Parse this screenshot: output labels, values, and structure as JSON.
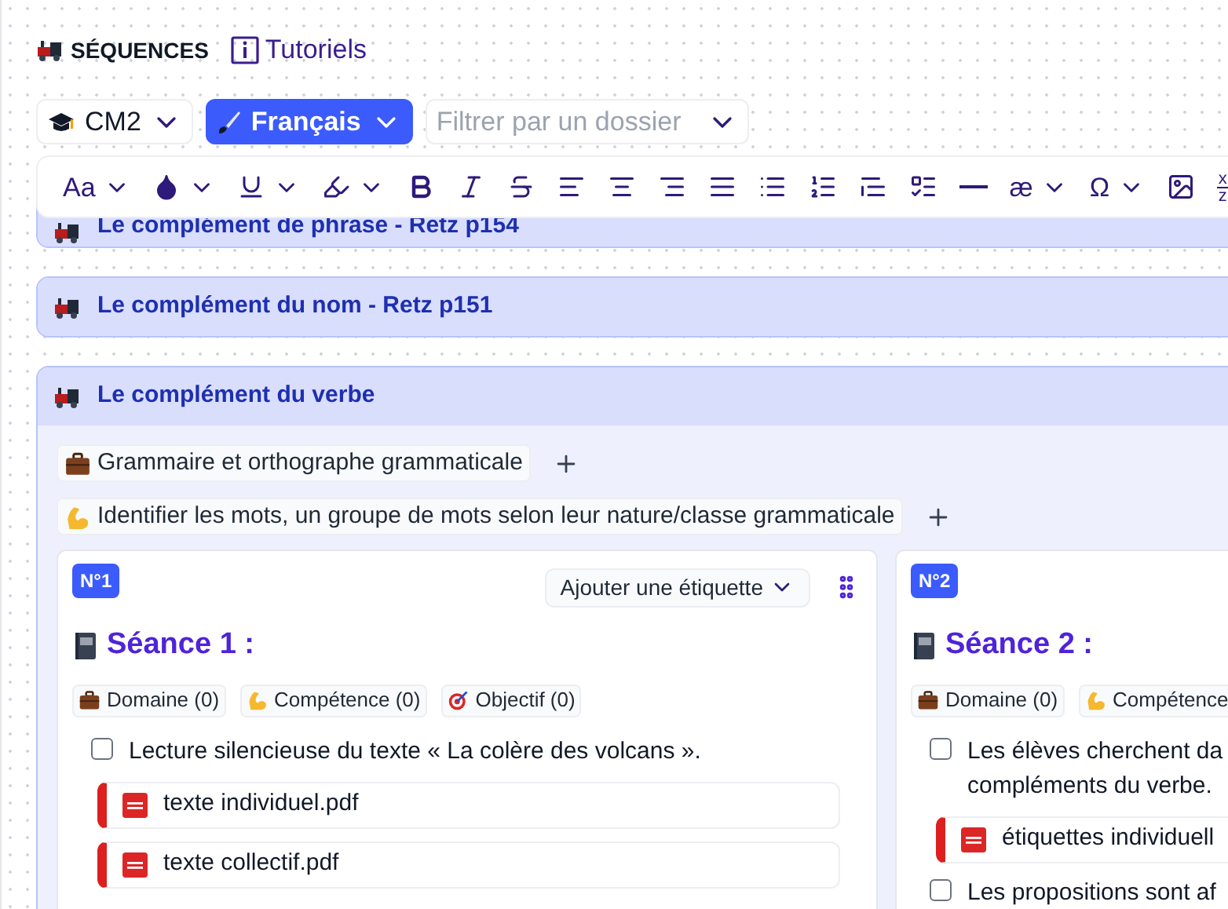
{
  "header": {
    "title": "SÉQUENCES",
    "link": "Tutoriels"
  },
  "filters": [
    {
      "kind": "level",
      "label": "CM2",
      "selected": false
    },
    {
      "kind": "subject",
      "label": "Français",
      "selected": true
    },
    {
      "kind": "folder",
      "placeholder": "Filtrer par un dossier",
      "selected": false
    }
  ],
  "toolbar": [
    {
      "kind": "text",
      "label": "Aa",
      "menu": true
    },
    {
      "kind": "color",
      "menu": true
    },
    {
      "kind": "underline",
      "menu": true
    },
    {
      "kind": "highlight",
      "menu": true
    },
    {
      "kind": "bold",
      "menu": false
    },
    {
      "kind": "italic",
      "menu": false
    },
    {
      "kind": "strike",
      "menu": false
    },
    {
      "kind": "align-left",
      "menu": false
    },
    {
      "kind": "align-center",
      "menu": false
    },
    {
      "kind": "align-right",
      "menu": false
    },
    {
      "kind": "align-justify",
      "menu": false
    },
    {
      "kind": "bullets",
      "menu": false
    },
    {
      "kind": "numbers",
      "menu": false
    },
    {
      "kind": "quote",
      "menu": false
    },
    {
      "kind": "checklist",
      "menu": false
    },
    {
      "kind": "rule",
      "menu": false
    },
    {
      "kind": "text",
      "label": "æ",
      "menu": true
    },
    {
      "kind": "text",
      "label": "Ω",
      "menu": true
    },
    {
      "kind": "image",
      "menu": false
    },
    {
      "kind": "fraction",
      "top": "x",
      "bottom": "z",
      "menu": false
    }
  ],
  "sequences": [
    {
      "title": "Le complément de phrase - Retz p154",
      "expanded": false
    },
    {
      "title": "Le complément du nom - Retz p151",
      "expanded": false
    },
    {
      "title": "Le complément du verbe",
      "expanded": true,
      "tags": [
        {
          "kind": "domain",
          "label": "Grammaire et orthographe grammaticale"
        },
        {
          "kind": "skill",
          "label": "Identifier les mots, un groupe de mots selon leur nature/classe grammaticale"
        }
      ],
      "sessions": [
        {
          "number": "N°1",
          "add_label": "Ajouter une étiquette",
          "title": "Séance 1 :",
          "chips": [
            {
              "kind": "domain",
              "label": "Domaine (0)"
            },
            {
              "kind": "skill",
              "label": "Compétence (0)"
            },
            {
              "kind": "goal",
              "label": "Objectif (0)"
            }
          ],
          "steps": [
            {
              "kind": "task",
              "lines": [
                "Lecture silencieuse du texte « La colère des volcans »."
              ],
              "checked": false
            },
            {
              "kind": "file",
              "name": "texte individuel.pdf"
            },
            {
              "kind": "file",
              "name": "texte collectif.pdf"
            }
          ]
        },
        {
          "number": "N°2",
          "title": "Séance 2 :",
          "chips": [
            {
              "kind": "domain",
              "label": "Domaine (0)"
            },
            {
              "kind": "skill",
              "label": "Compétence"
            }
          ],
          "steps": [
            {
              "kind": "task",
              "lines": [
                "Les élèves cherchent da",
                "compléments du verbe."
              ],
              "checked": false
            },
            {
              "kind": "file",
              "name": "étiquettes individuell"
            },
            {
              "kind": "task",
              "lines": [
                "Les propositions sont af"
              ],
              "checked": false
            }
          ]
        }
      ]
    }
  ]
}
